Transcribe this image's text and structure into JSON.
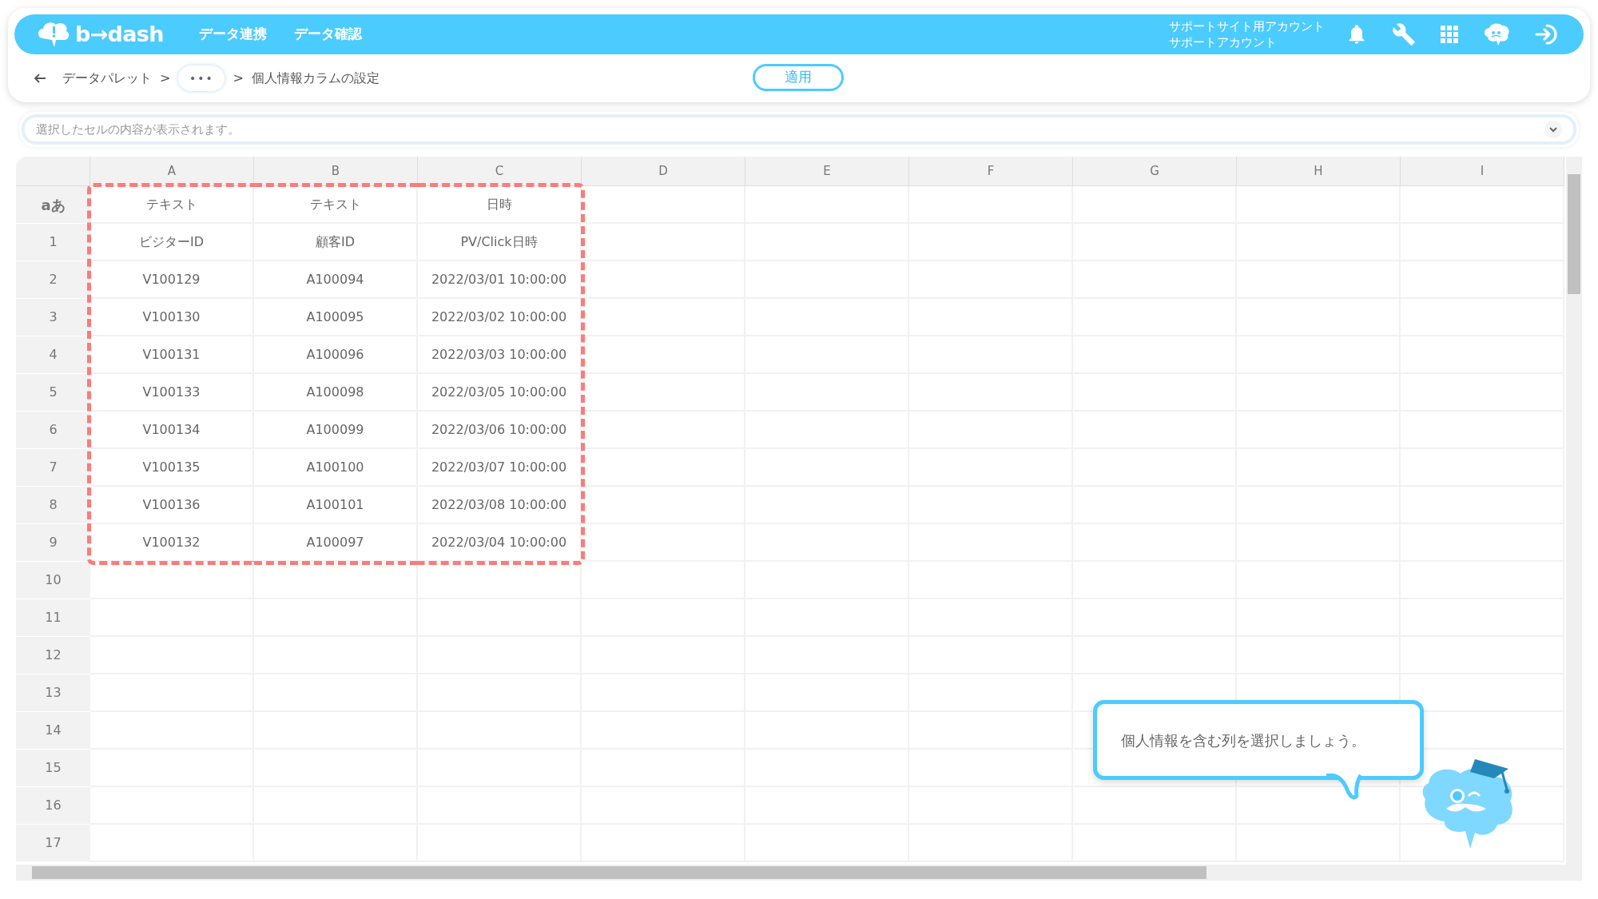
{
  "header": {
    "logo": "b→dash",
    "nav": [
      "データ連携",
      "データ確認"
    ],
    "account": [
      "サポートサイト用アカウント",
      "サポートアカウント"
    ]
  },
  "breadcrumb": {
    "items": [
      "データパレット",
      ">",
      "•••",
      ">",
      "個人情報カラムの設定"
    ],
    "apply_button": "適用"
  },
  "formula_bar": {
    "placeholder": "選択したセルの内容が表示されます。"
  },
  "grid": {
    "columns": [
      {
        "label": "A",
        "outlined": true
      },
      {
        "label": "B",
        "outlined": true
      },
      {
        "label": "C",
        "outlined": true
      },
      {
        "label": "D",
        "outlined": false
      },
      {
        "label": "E",
        "outlined": false
      },
      {
        "label": "F",
        "outlined": false
      },
      {
        "label": "G",
        "outlined": false
      },
      {
        "label": "H",
        "outlined": false
      },
      {
        "label": "I",
        "outlined": false
      }
    ],
    "rows": [
      {
        "label": "aあ",
        "kind": "type",
        "cells": [
          "テキスト",
          "テキスト",
          "日時"
        ]
      },
      {
        "label": "1",
        "kind": "data",
        "cells": [
          "ビジターID",
          "顧客ID",
          "PV/Click日時"
        ]
      },
      {
        "label": "2",
        "kind": "data",
        "cells": [
          "V100129",
          "A100094",
          "2022/03/01 10:00:00"
        ]
      },
      {
        "label": "3",
        "kind": "data",
        "cells": [
          "V100130",
          "A100095",
          "2022/03/02 10:00:00"
        ]
      },
      {
        "label": "4",
        "kind": "data",
        "cells": [
          "V100131",
          "A100096",
          "2022/03/03 10:00:00"
        ]
      },
      {
        "label": "5",
        "kind": "data",
        "cells": [
          "V100133",
          "A100098",
          "2022/03/05 10:00:00"
        ]
      },
      {
        "label": "6",
        "kind": "data",
        "cells": [
          "V100134",
          "A100099",
          "2022/03/06 10:00:00"
        ]
      },
      {
        "label": "7",
        "kind": "data",
        "cells": [
          "V100135",
          "A100100",
          "2022/03/07 10:00:00"
        ]
      },
      {
        "label": "8",
        "kind": "data",
        "cells": [
          "V100136",
          "A100101",
          "2022/03/08 10:00:00"
        ]
      },
      {
        "label": "9",
        "kind": "data",
        "cells": [
          "V100132",
          "A100097",
          "2022/03/04 10:00:00"
        ]
      },
      {
        "label": "10",
        "kind": "data",
        "cells": []
      },
      {
        "label": "11",
        "kind": "data",
        "cells": []
      },
      {
        "label": "12",
        "kind": "data",
        "cells": []
      },
      {
        "label": "13",
        "kind": "data",
        "cells": []
      },
      {
        "label": "14",
        "kind": "data",
        "cells": []
      },
      {
        "label": "15",
        "kind": "data",
        "cells": []
      },
      {
        "label": "16",
        "kind": "data",
        "cells": []
      },
      {
        "label": "17",
        "kind": "data",
        "cells": []
      }
    ]
  },
  "tip": {
    "text": "個人情報を含む列を選択しましょう。"
  }
}
